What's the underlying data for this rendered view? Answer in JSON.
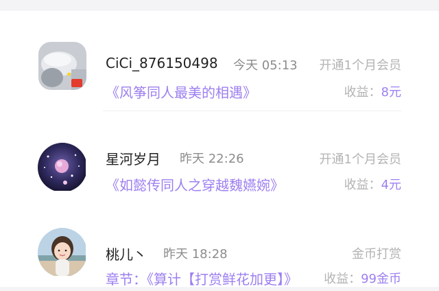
{
  "records": [
    {
      "name": "CiCi_876150498",
      "time": "今天 05:13",
      "action": "开通1个月会员",
      "title": "《风筝同人最美的相遇》",
      "earn_label": "收益：",
      "earn_amount": "8元",
      "avatar": "avatar-cap-photo"
    },
    {
      "name": "星河岁月",
      "time": "昨天 22:26",
      "action": "开通1个月会员",
      "title": "《如懿传同人之穿越魏嬿婉》",
      "earn_label": "收益：",
      "earn_amount": "4元",
      "avatar": "avatar-galaxy"
    },
    {
      "name": "桃儿丶",
      "time": "昨天 18:28",
      "action": "金币打赏",
      "title": "章节：《算计【打赏鲜花加更】》",
      "earn_label": "收益：",
      "earn_amount": "99金币",
      "avatar": "avatar-girl-photo"
    }
  ],
  "colors": {
    "accent": "#9d7ff0",
    "muted": "#b3b3b3",
    "time": "#8c8c8c",
    "name": "#222222",
    "background": "#ffffff",
    "bar": "#f4f4f6"
  }
}
